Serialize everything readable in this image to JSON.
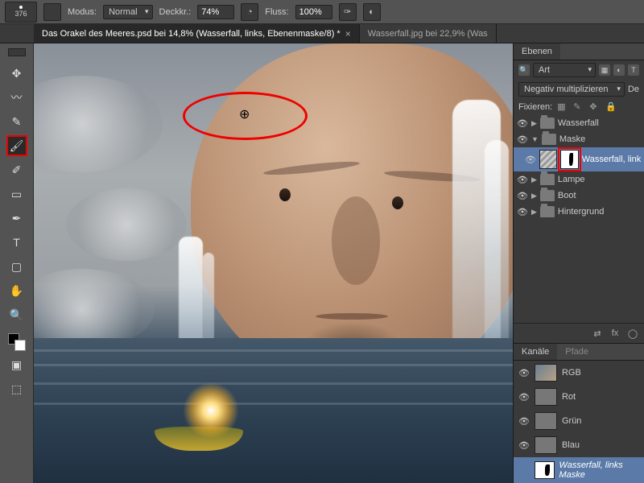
{
  "toolbar": {
    "brush_size": "376",
    "mode_label": "Modus:",
    "mode_value": "Normal",
    "opacity_label": "Deckkr.:",
    "opacity_value": "74%",
    "flow_label": "Fluss:",
    "flow_value": "100%"
  },
  "tabs": [
    {
      "title": "Das Orakel des Meeres.psd bei 14,8% (Wasserfall, links, Ebenenmaske/8) *",
      "active": true
    },
    {
      "title": "Wasserfall.jpg bei 22,9% (Was",
      "active": false
    }
  ],
  "panels": {
    "layers_tab": "Ebenen",
    "filter_label": "Art",
    "blend_mode": "Negativ multiplizieren",
    "blend_short": "De",
    "lock_label": "Fixieren:",
    "layers": [
      {
        "name": "Wasserfall",
        "type": "folder"
      },
      {
        "name": "Maske",
        "type": "folder"
      },
      {
        "name": "Wasserfall, links",
        "type": "layer_mask",
        "selected": true
      },
      {
        "name": "Lampe",
        "type": "folder"
      },
      {
        "name": "Boot",
        "type": "folder"
      },
      {
        "name": "Hintergrund",
        "type": "folder"
      }
    ],
    "channels_tab": "Kanäle",
    "paths_tab": "Pfade",
    "channels": [
      {
        "name": "RGB"
      },
      {
        "name": "Rot"
      },
      {
        "name": "Grün"
      },
      {
        "name": "Blau"
      },
      {
        "name": "Wasserfall, links Maske",
        "mask": true,
        "selected": true
      }
    ]
  }
}
